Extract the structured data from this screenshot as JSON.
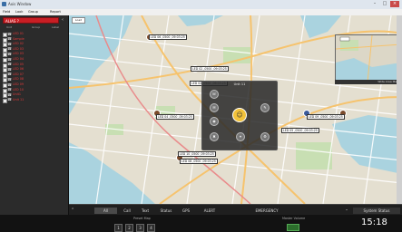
{
  "window": {
    "title": "Axis Window"
  },
  "menu": [
    "Field",
    "Look",
    "Group",
    "Report"
  ],
  "search": {
    "value": "ALIAS ?"
  },
  "columns": [
    "Unit",
    "Group",
    "Label"
  ],
  "devices": [
    {
      "label": "LED 01",
      "color": "#e23a3a"
    },
    {
      "label": "Sample",
      "color": "#e23a3a"
    },
    {
      "label": "LED 02",
      "color": "#e23a3a"
    },
    {
      "label": "LED 03",
      "color": "#e23a3a"
    },
    {
      "label": "LED 03",
      "color": "#e23a3a"
    },
    {
      "label": "LED 04",
      "color": "#e23a3a"
    },
    {
      "label": "LED 05",
      "color": "#e23a3a"
    },
    {
      "label": "LED 06",
      "color": "#e23a3a"
    },
    {
      "label": "LED 07",
      "color": "#e23a3a"
    },
    {
      "label": "LED 08",
      "color": "#e23a3a"
    },
    {
      "label": "LED 09",
      "color": "#e23a3a"
    },
    {
      "label": "LED 10",
      "color": "#e23a3a"
    },
    {
      "label": "Unit1",
      "color": "#e23a3a"
    },
    {
      "label": "Unit 11",
      "color": "#e23a3a"
    }
  ],
  "map": {
    "button": "Load",
    "labels": [
      "LED 06 ,0500 ,09:03:25",
      "LED 02 ,0500 ,09:03:25",
      "LED 02 ,0500 ,09:03:25",
      "LED 04 ,0500 ,09:03:25",
      "LED 08 ,0500 ,09:03:25",
      "LED 09 ,0500 ,09:03:25",
      "LED 05 ,0500 ,09:03:25",
      "LED 10 ,0500 ,09:03:25"
    ],
    "popup_title": "Unit 11",
    "minimap_label": "Wide Area Map"
  },
  "tabs": [
    "All",
    "Call",
    "Text",
    "Status",
    "GPS",
    "ALERT",
    "EMERGENCY"
  ],
  "system_status": "System Status",
  "preset": {
    "label": "Preset Map",
    "buttons": [
      "1",
      "2",
      "3",
      "4"
    ]
  },
  "volume_label": "Master Volume",
  "clock": "15:18"
}
